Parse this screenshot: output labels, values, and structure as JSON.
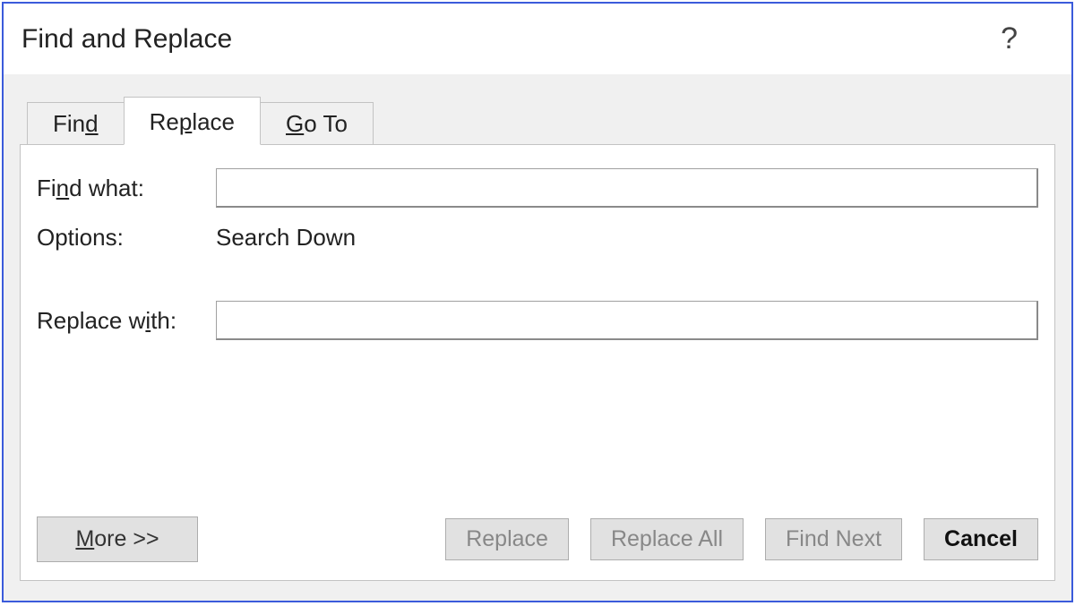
{
  "window": {
    "title": "Find and Replace",
    "help": "?"
  },
  "tabs": {
    "find_pre": "Fin",
    "find_u": "d",
    "find_post": "",
    "replace_pre": "Re",
    "replace_u": "p",
    "replace_post": "lace",
    "goto_pre": "",
    "goto_u": "G",
    "goto_post": "o To"
  },
  "form": {
    "find_label_pre": "Fi",
    "find_label_u": "n",
    "find_label_post": "d what:",
    "find_value": "",
    "options_label": "Options:",
    "options_value": "Search Down",
    "replace_label_pre": "Replace w",
    "replace_label_u": "i",
    "replace_label_post": "th:",
    "replace_value": ""
  },
  "buttons": {
    "more_pre": "",
    "more_u": "M",
    "more_post": "ore >>",
    "replace": "Replace",
    "replace_all": "Replace All",
    "find_next": "Find Next",
    "cancel": "Cancel"
  }
}
